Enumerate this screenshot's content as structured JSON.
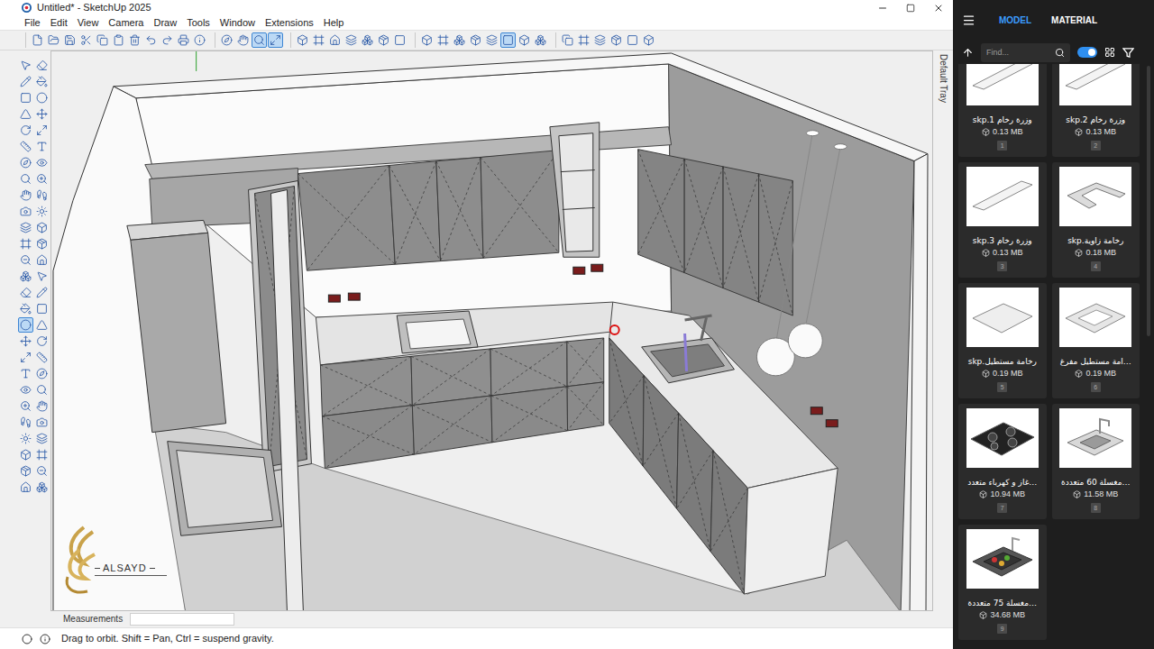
{
  "window": {
    "title": "Untitled* - SketchUp 2025"
  },
  "menu": [
    "File",
    "Edit",
    "View",
    "Camera",
    "Draw",
    "Tools",
    "Window",
    "Extensions",
    "Help"
  ],
  "toolbar": {
    "groups": [
      [
        {
          "selected": false
        },
        {
          "selected": false
        },
        {
          "selected": false
        },
        {
          "selected": false
        },
        {
          "selected": false
        },
        {
          "selected": false
        },
        {
          "selected": false
        },
        {
          "selected": false
        },
        {
          "selected": false
        },
        {
          "selected": false
        },
        {
          "selected": false
        }
      ],
      [
        {
          "selected": false
        },
        {
          "selected": false
        },
        {
          "selected": true
        },
        {
          "selected": true
        }
      ],
      [
        {
          "selected": false
        },
        {
          "selected": false
        },
        {
          "selected": false
        },
        {
          "selected": false
        },
        {
          "selected": false
        },
        {
          "selected": false
        },
        {
          "selected": false
        }
      ],
      [
        {
          "selected": false
        },
        {
          "selected": false
        },
        {
          "selected": false
        },
        {
          "selected": false
        },
        {
          "selected": false
        },
        {
          "selected": true
        },
        {
          "selected": false
        },
        {
          "selected": false
        }
      ],
      [
        {
          "selected": false
        },
        {
          "selected": false
        },
        {
          "selected": false
        },
        {
          "selected": false
        },
        {
          "selected": false
        },
        {
          "selected": false
        }
      ]
    ]
  },
  "left_toolbar": {
    "buttons": [
      {
        "selected": false
      },
      {
        "selected": false
      },
      {
        "selected": false
      },
      {
        "selected": false
      },
      {
        "selected": false
      },
      {
        "selected": false
      },
      {
        "selected": false
      },
      {
        "selected": false
      },
      {
        "selected": false
      },
      {
        "selected": false
      },
      {
        "selected": false
      },
      {
        "selected": false
      },
      {
        "selected": false
      },
      {
        "selected": false
      },
      {
        "selected": false
      },
      {
        "selected": false
      },
      {
        "selected": false
      },
      {
        "selected": false
      },
      {
        "selected": false
      },
      {
        "selected": false
      },
      {
        "selected": false
      },
      {
        "selected": false
      },
      {
        "selected": false
      },
      {
        "selected": false
      },
      {
        "selected": false
      },
      {
        "selected": false
      },
      {
        "selected": false
      },
      {
        "selected": false
      },
      {
        "selected": false
      },
      {
        "selected": false
      },
      {
        "selected": false
      },
      {
        "selected": false
      },
      {
        "selected": true
      },
      {
        "selected": false
      },
      {
        "selected": false
      },
      {
        "selected": false
      },
      {
        "selected": false
      },
      {
        "selected": false
      },
      {
        "selected": false
      },
      {
        "selected": false
      },
      {
        "selected": false
      },
      {
        "selected": false
      },
      {
        "selected": false
      },
      {
        "selected": false
      },
      {
        "selected": false
      },
      {
        "selected": false
      },
      {
        "selected": false
      },
      {
        "selected": false
      },
      {
        "selected": false
      },
      {
        "selected": false
      },
      {
        "selected": false
      },
      {
        "selected": false
      },
      {
        "selected": false
      },
      {
        "selected": false
      }
    ]
  },
  "viewport": {
    "watermark": "ALSAYD",
    "tray_tab": "Default Tray"
  },
  "measurements": {
    "label": "Measurements",
    "value": ""
  },
  "status_bar": {
    "text": "Drag to orbit. Shift = Pan, Ctrl = suspend gravity."
  },
  "warehouse": {
    "tabs": [
      {
        "label": "MODEL",
        "selected": true
      },
      {
        "label": "MATERIAL",
        "selected": false
      }
    ],
    "search": {
      "placeholder": "Find..."
    },
    "toggle": {
      "on": true
    },
    "items": [
      {
        "name": "وزرة رخام 1.skp",
        "size": "0.13 MB",
        "index": "1",
        "kind": "strip"
      },
      {
        "name": "وزرة رخام 2.skp",
        "size": "0.13 MB",
        "index": "2",
        "kind": "strip"
      },
      {
        "name": "وزرة رخام 3.skp",
        "size": "0.13 MB",
        "index": "3",
        "kind": "strip"
      },
      {
        "name": "رخامة زاوية.skp",
        "size": "0.18 MB",
        "index": "4",
        "kind": "corner"
      },
      {
        "name": "رخامة مستطيل.skp",
        "size": "0.19 MB",
        "index": "5",
        "kind": "slab"
      },
      {
        "name": "…امة مستطيل مفرغ",
        "size": "0.19 MB",
        "index": "6",
        "kind": "frame"
      },
      {
        "name": "…غاز و كهرباء متعدد",
        "size": "10.94 MB",
        "index": "7",
        "kind": "hob"
      },
      {
        "name": "…مغسلة 60 متعددة",
        "size": "11.58 MB",
        "index": "8",
        "kind": "sink"
      },
      {
        "name": "…مغسلة 75 متعددة",
        "size": "34.68 MB",
        "index": "9",
        "kind": "basin"
      }
    ]
  }
}
